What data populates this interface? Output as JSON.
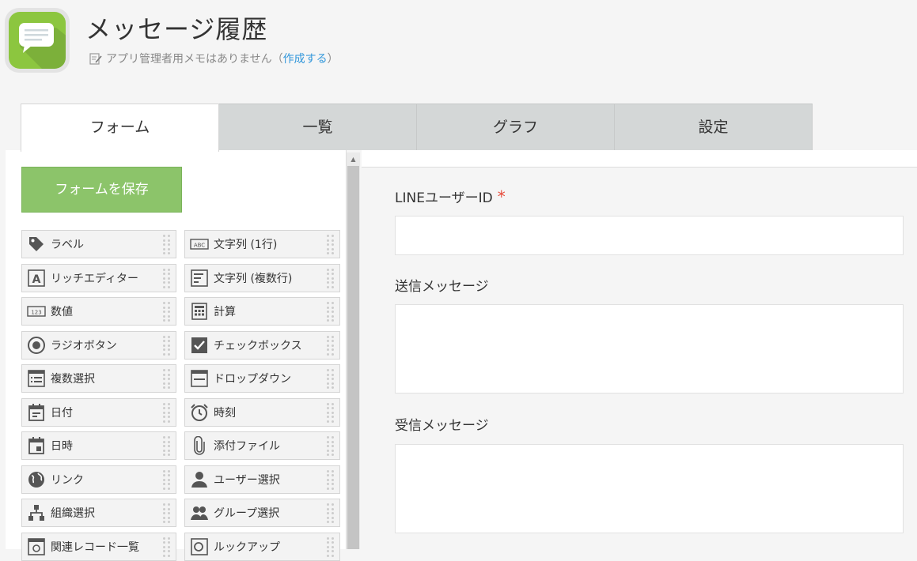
{
  "header": {
    "app_title": "メッセージ履歴",
    "memo_text": "アプリ管理者用メモはありません（",
    "memo_link": "作成する",
    "memo_close": "）"
  },
  "tabs": [
    {
      "label": "フォーム",
      "active": true
    },
    {
      "label": "一覧",
      "active": false
    },
    {
      "label": "グラフ",
      "active": false
    },
    {
      "label": "設定",
      "active": false
    }
  ],
  "palette": {
    "save_label": "フォームを保存",
    "items": [
      {
        "label": "ラベル",
        "icon": "tag-icon"
      },
      {
        "label": "文字列 (1行)",
        "icon": "abc-text-icon"
      },
      {
        "label": "リッチエディター",
        "icon": "rich-editor-icon"
      },
      {
        "label": "文字列 (複数行)",
        "icon": "multiline-text-icon"
      },
      {
        "label": "数値",
        "icon": "number-123-icon"
      },
      {
        "label": "計算",
        "icon": "calculator-icon"
      },
      {
        "label": "ラジオボタン",
        "icon": "radio-button-icon"
      },
      {
        "label": "チェックボックス",
        "icon": "checkbox-icon"
      },
      {
        "label": "複数選択",
        "icon": "multi-select-icon"
      },
      {
        "label": "ドロップダウン",
        "icon": "dropdown-icon"
      },
      {
        "label": "日付",
        "icon": "date-icon"
      },
      {
        "label": "時刻",
        "icon": "alarm-clock-icon"
      },
      {
        "label": "日時",
        "icon": "datetime-icon"
      },
      {
        "label": "添付ファイル",
        "icon": "paperclip-icon"
      },
      {
        "label": "リンク",
        "icon": "globe-icon"
      },
      {
        "label": "ユーザー選択",
        "icon": "user-icon"
      },
      {
        "label": "組織選択",
        "icon": "org-tree-icon"
      },
      {
        "label": "グループ選択",
        "icon": "group-icon"
      },
      {
        "label": "関連レコード一覧",
        "icon": "related-records-icon"
      },
      {
        "label": "ルックアップ",
        "icon": "lookup-icon"
      }
    ]
  },
  "form": {
    "fields": [
      {
        "label": "LINEユーザーID",
        "required": true,
        "required_mark": "*"
      },
      {
        "label": "送信メッセージ",
        "required": false
      },
      {
        "label": "受信メッセージ",
        "required": false
      }
    ]
  },
  "colors": {
    "accent_green": "#8cc46a",
    "app_icon_green": "#8cc63f",
    "link_blue": "#3498db",
    "required_red": "#e74c3c"
  }
}
